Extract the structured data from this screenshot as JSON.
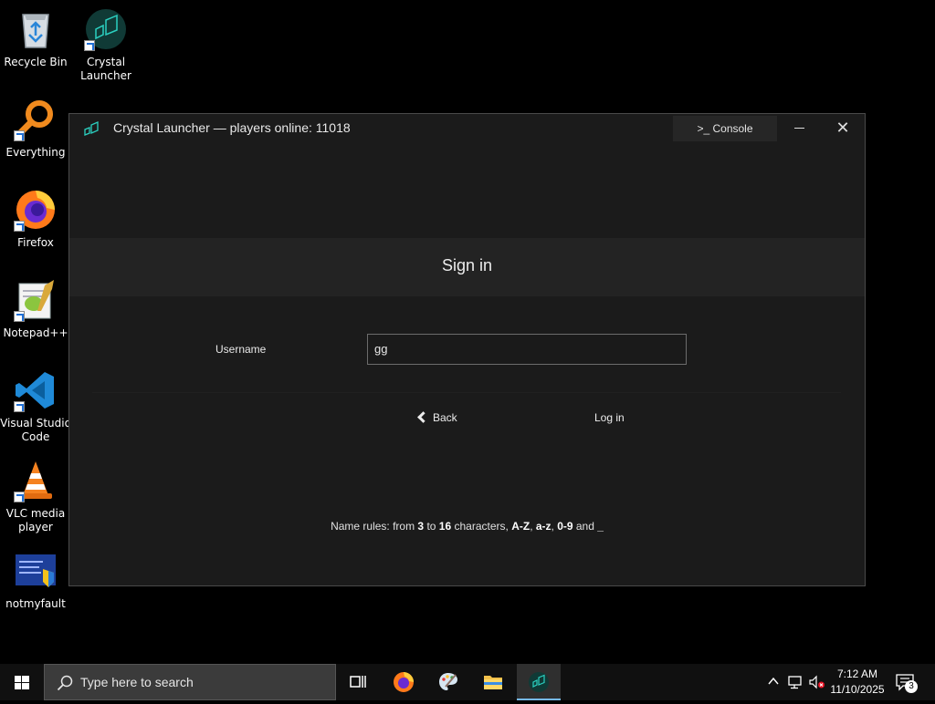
{
  "desktop": {
    "icons": [
      {
        "label": "Recycle Bin",
        "icon": "recycle-bin-icon"
      },
      {
        "label": "Crystal\nLauncher",
        "icon": "crystal-launcher-icon"
      },
      {
        "label": "Everything",
        "icon": "everything-search-icon"
      },
      {
        "label": "Firefox",
        "icon": "firefox-icon"
      },
      {
        "label": "Notepad++",
        "icon": "notepad-plus-plus-icon"
      },
      {
        "label": "Visual Studio\nCode",
        "icon": "vscode-icon"
      },
      {
        "label": "VLC media\nplayer",
        "icon": "vlc-icon"
      },
      {
        "label": "notmyfault",
        "icon": "notmyfault-icon"
      }
    ]
  },
  "window": {
    "title": "Crystal Launcher — players online: 11018",
    "console_label": ">_ Console",
    "close_glyph": "✕",
    "heading": "Sign in",
    "username_label": "Username",
    "username_value": "gg",
    "back_label": "Back",
    "login_label": "Log in",
    "rules": {
      "prefix": "Name rules: from ",
      "min": "3",
      "to": " to ",
      "max": "16",
      "chars": " characters, ",
      "upper": "A-Z",
      "sep1": ", ",
      "lower": "a-z",
      "sep2": ", ",
      "digits": "0-9",
      "and": " and ",
      "underscore": "_"
    },
    "colors": {
      "background": "#1b1b1b",
      "band": "#232323",
      "accent": "#1fa39a"
    }
  },
  "taskbar": {
    "search_placeholder": "Type here to search",
    "apps": [
      "task-view-icon",
      "firefox-icon",
      "paint-icon",
      "file-explorer-icon",
      "crystal-launcher-icon"
    ],
    "active_app": "crystal-launcher-icon",
    "clock_time": "7:12 AM",
    "clock_date": "11/10/2025",
    "notification_count": "3"
  }
}
